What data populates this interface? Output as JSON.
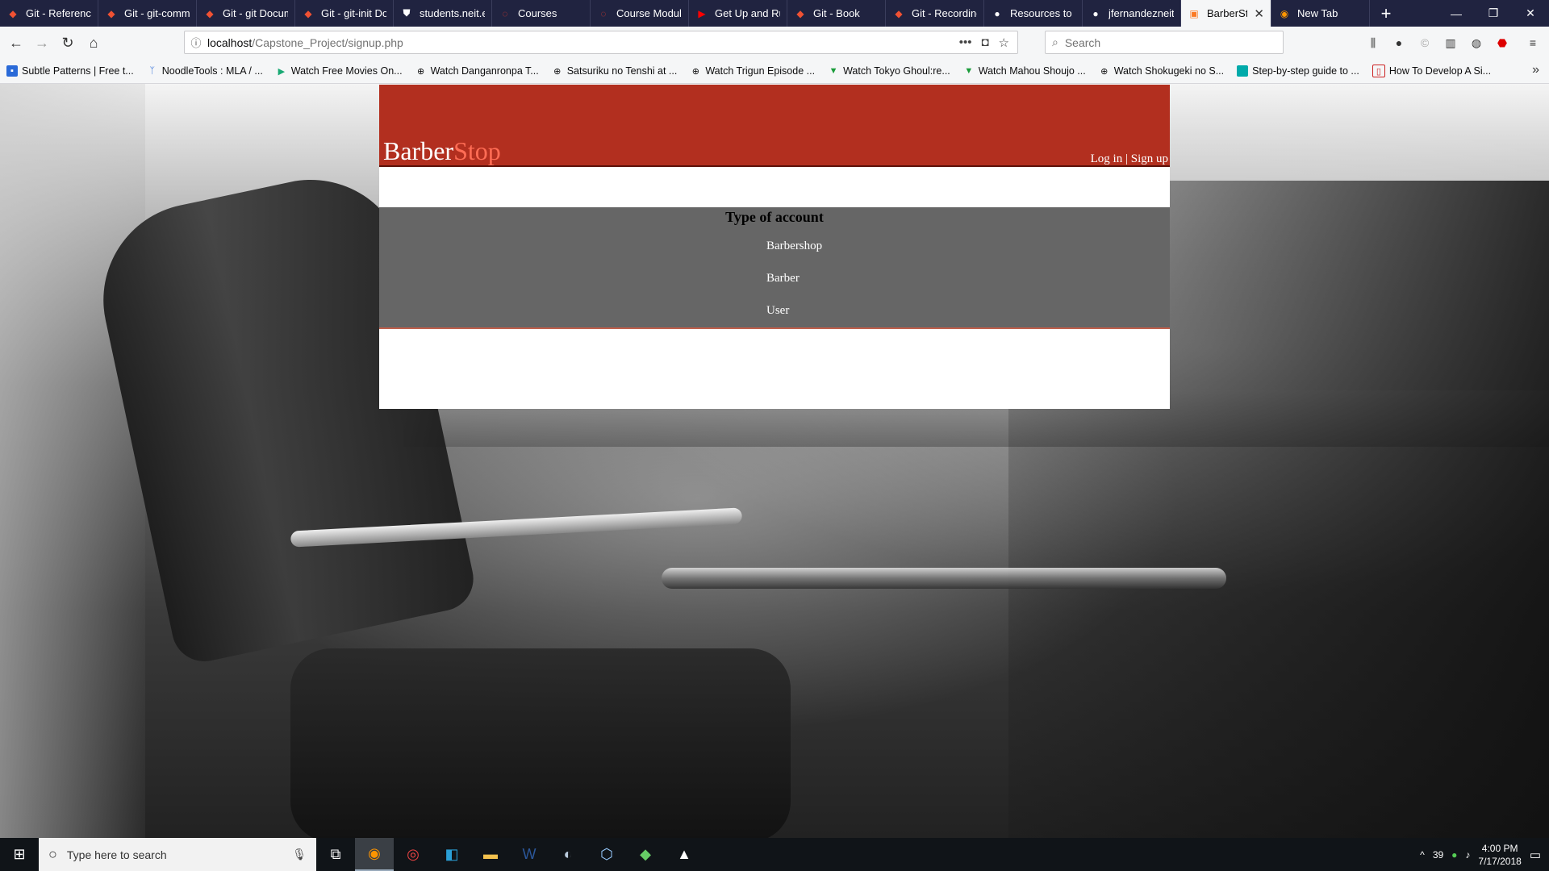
{
  "browser": {
    "tabs": [
      {
        "title": "Git - Reference",
        "icon": "git-icon",
        "color": "#f05133"
      },
      {
        "title": "Git - git-comm",
        "icon": "git-icon",
        "color": "#f05133"
      },
      {
        "title": "Git - git Docum",
        "icon": "git-icon",
        "color": "#f05133"
      },
      {
        "title": "Git - git-init Do",
        "icon": "git-icon",
        "color": "#f05133"
      },
      {
        "title": "students.neit.e",
        "icon": "shield-icon",
        "color": "#ffffff"
      },
      {
        "title": "Courses",
        "icon": "loading-ring-icon",
        "color": "#e03a2c"
      },
      {
        "title": "Course Module",
        "icon": "loading-ring-icon",
        "color": "#e03a2c"
      },
      {
        "title": "Get Up and Ru",
        "icon": "youtube-icon",
        "color": "#ff0000"
      },
      {
        "title": "Git - Book",
        "icon": "git-icon",
        "color": "#f05133"
      },
      {
        "title": "Git - Recording",
        "icon": "git-icon",
        "color": "#f05133"
      },
      {
        "title": "Resources to le",
        "icon": "github-icon",
        "color": "#ffffff"
      },
      {
        "title": "jfernandezneit/",
        "icon": "github-icon",
        "color": "#ffffff"
      },
      {
        "title": "BarberStop",
        "icon": "xampp-icon",
        "color": "#fb7a24"
      },
      {
        "title": "New Tab",
        "icon": "firefox-icon",
        "color": "#ff9500"
      }
    ],
    "url_host": "localhost",
    "url_path": "/Capstone_Project/signup.php",
    "search_placeholder": "Search",
    "bookmarks": [
      "Subtle Patterns | Free t...",
      "NoodleTools : MLA / ...",
      "Watch Free Movies On...",
      "Watch Danganronpa T...",
      "Satsuriku no Tenshi at ...",
      "Watch Trigun Episode ...",
      "Watch Tokyo Ghoul:re...",
      "Watch Mahou Shoujo ...",
      "Watch Shokugeki no S...",
      "Step-by-step guide to ...",
      "How To Develop A Si..."
    ]
  },
  "site": {
    "logo_part1": "Barber",
    "logo_part2": "Stop",
    "login": "Log in",
    "separator": " | ",
    "signup": "Sign up",
    "account_title": "Type of account",
    "account_options": [
      "Barbershop",
      "Barber",
      "User"
    ],
    "colors": {
      "header": "#b22f1f",
      "logo_accent": "#ff6d55",
      "panel": "#666666"
    }
  },
  "taskbar": {
    "search_placeholder": "Type here to search",
    "temperature": "39",
    "time": "4:00 PM",
    "date": "7/17/2018"
  }
}
